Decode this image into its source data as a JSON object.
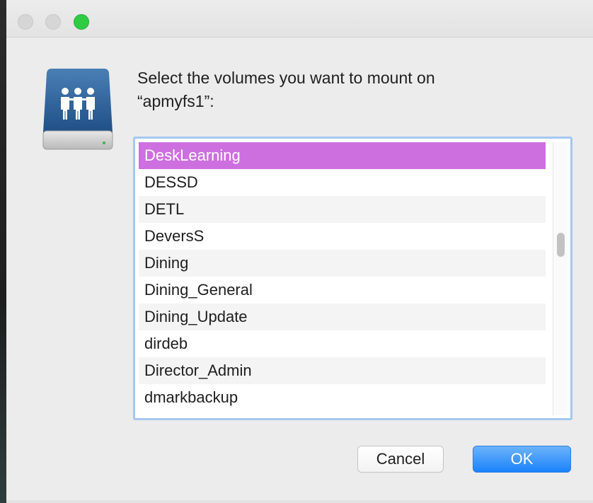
{
  "window": {
    "controls": [
      "close",
      "minimize",
      "zoom"
    ],
    "colors": {
      "zoom": "#2fcb43",
      "inactive_control": "#d6d6d6"
    }
  },
  "dialog": {
    "icon": "network-server-icon",
    "prompt_line1": "Select the volumes you want to mount on",
    "prompt_line2": "“apmyfs1”:",
    "volumes": [
      "DeskLearning",
      "DESSD",
      "DETL",
      "DeversS",
      "Dining",
      "Dining_General",
      "Dining_Update",
      "dirdeb",
      "Director_Admin",
      "dmarkbackup"
    ],
    "selected_volume": "DeskLearning",
    "selection_color": "#cd6fdf",
    "cancel_label": "Cancel",
    "ok_label": "OK",
    "ok_color": "#1a82fb"
  }
}
